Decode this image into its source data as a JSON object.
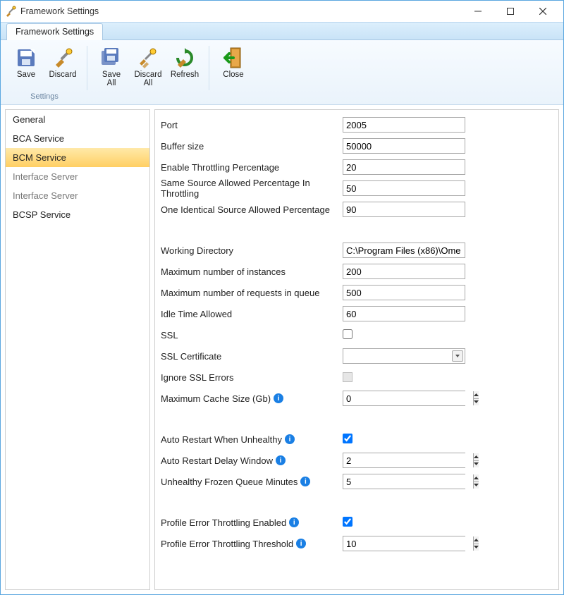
{
  "window": {
    "title": "Framework Settings",
    "tab": "Framework Settings"
  },
  "ribbon": {
    "groups": [
      {
        "label": "Settings",
        "buttons": [
          {
            "key": "save",
            "label": "Save"
          },
          {
            "key": "discard",
            "label": "Discard"
          }
        ]
      },
      {
        "label": "",
        "buttons": [
          {
            "key": "save-all",
            "label": "Save\nAll"
          },
          {
            "key": "discard-all",
            "label": "Discard\nAll"
          },
          {
            "key": "refresh",
            "label": "Refresh"
          }
        ]
      },
      {
        "label": "",
        "buttons": [
          {
            "key": "close",
            "label": "Close"
          }
        ]
      }
    ]
  },
  "sidebar": {
    "items": [
      {
        "label": "General",
        "selected": false
      },
      {
        "label": "BCA Service",
        "selected": false
      },
      {
        "label": "BCM Service",
        "selected": true
      },
      {
        "label": "Interface Server",
        "selected": false,
        "dim": true
      },
      {
        "label": "Interface Server",
        "selected": false,
        "dim": true
      },
      {
        "label": "BCSP Service",
        "selected": false
      }
    ]
  },
  "form": {
    "port": {
      "label": "Port",
      "value": "2005"
    },
    "bufferSize": {
      "label": "Buffer size",
      "value": "50000"
    },
    "enableThrottling": {
      "label": "Enable Throttling Percentage",
      "value": "20"
    },
    "sameSource": {
      "label": "Same Source Allowed Percentage In Throttling",
      "value": "50"
    },
    "oneIdentical": {
      "label": "One Identical Source Allowed Percentage",
      "value": "90"
    },
    "workingDir": {
      "label": "Working Directory",
      "value": "C:\\Program Files (x86)\\Ome"
    },
    "maxInstances": {
      "label": "Maximum number of instances",
      "value": "200"
    },
    "maxRequests": {
      "label": "Maximum number of requests in queue",
      "value": "500"
    },
    "idleTime": {
      "label": "Idle Time Allowed",
      "value": "60"
    },
    "ssl": {
      "label": "SSL",
      "checked": false
    },
    "sslCert": {
      "label": "SSL Certificate",
      "value": ""
    },
    "ignoreSslErrors": {
      "label": "Ignore SSL Errors",
      "checked": false
    },
    "maxCache": {
      "label": "Maximum Cache Size (Gb)",
      "value": "0",
      "info": true
    },
    "autoRestart": {
      "label": "Auto Restart When Unhealthy",
      "checked": true,
      "info": true
    },
    "autoRestartDelay": {
      "label": "Auto Restart Delay Window",
      "value": "2",
      "info": true
    },
    "unhealthyFrozen": {
      "label": "Unhealthy Frozen Queue Minutes",
      "value": "5",
      "info": true
    },
    "profileErrEnabled": {
      "label": "Profile Error Throttling Enabled",
      "checked": true,
      "info": true
    },
    "profileErrThreshold": {
      "label": "Profile Error Throttling Threshold",
      "value": "10",
      "info": true
    }
  }
}
